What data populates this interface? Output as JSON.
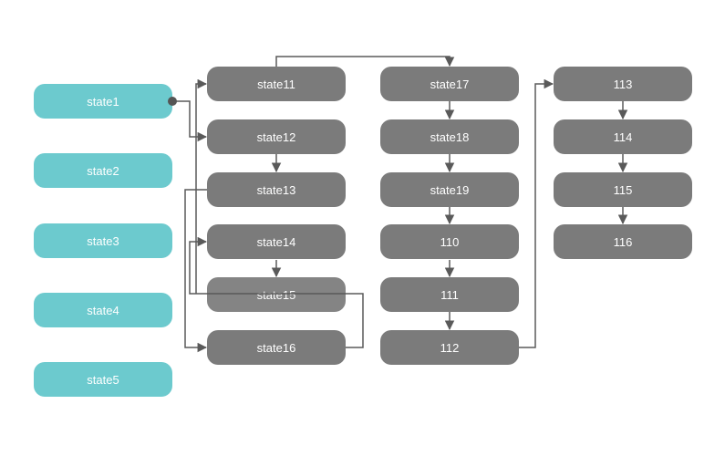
{
  "colors": {
    "source": "#6ccace",
    "state": "#7b7b7b",
    "connector": "#5a5a5a",
    "background": "#ffffff"
  },
  "sources": [
    {
      "id": "state1",
      "label": "state1"
    },
    {
      "id": "state2",
      "label": "state2"
    },
    {
      "id": "state3",
      "label": "state3"
    },
    {
      "id": "state4",
      "label": "state4"
    },
    {
      "id": "state5",
      "label": "state5"
    }
  ],
  "columns": [
    [
      {
        "id": "state11",
        "label": "state11"
      },
      {
        "id": "state12",
        "label": "state12"
      },
      {
        "id": "state13",
        "label": "state13"
      },
      {
        "id": "state14",
        "label": "state14"
      },
      {
        "id": "state15",
        "label": "state15"
      },
      {
        "id": "state16",
        "label": "state16"
      }
    ],
    [
      {
        "id": "state17",
        "label": "state17"
      },
      {
        "id": "state18",
        "label": "state18"
      },
      {
        "id": "state19",
        "label": "state19"
      },
      {
        "id": "110",
        "label": "110"
      },
      {
        "id": "111",
        "label": "111"
      },
      {
        "id": "112",
        "label": "112"
      }
    ],
    [
      {
        "id": "113",
        "label": "113"
      },
      {
        "id": "114",
        "label": "114"
      },
      {
        "id": "115",
        "label": "115"
      },
      {
        "id": "116",
        "label": "116"
      }
    ]
  ],
  "edges": [
    {
      "from": "state1",
      "to": "state11"
    },
    {
      "from": "state1",
      "to": "state12"
    },
    {
      "from": "state12",
      "to": "state13"
    },
    {
      "from": "state13",
      "to": "state16"
    },
    {
      "from": "state14",
      "to": "state15"
    },
    {
      "from": "state16",
      "to": "state14"
    },
    {
      "from": "state11",
      "to": "state17"
    },
    {
      "from": "state17",
      "to": "state18"
    },
    {
      "from": "state18",
      "to": "state19"
    },
    {
      "from": "state19",
      "to": "110"
    },
    {
      "from": "110",
      "to": "111"
    },
    {
      "from": "111",
      "to": "112"
    },
    {
      "from": "112",
      "to": "113"
    },
    {
      "from": "113",
      "to": "114"
    },
    {
      "from": "114",
      "to": "115"
    },
    {
      "from": "115",
      "to": "116"
    }
  ]
}
